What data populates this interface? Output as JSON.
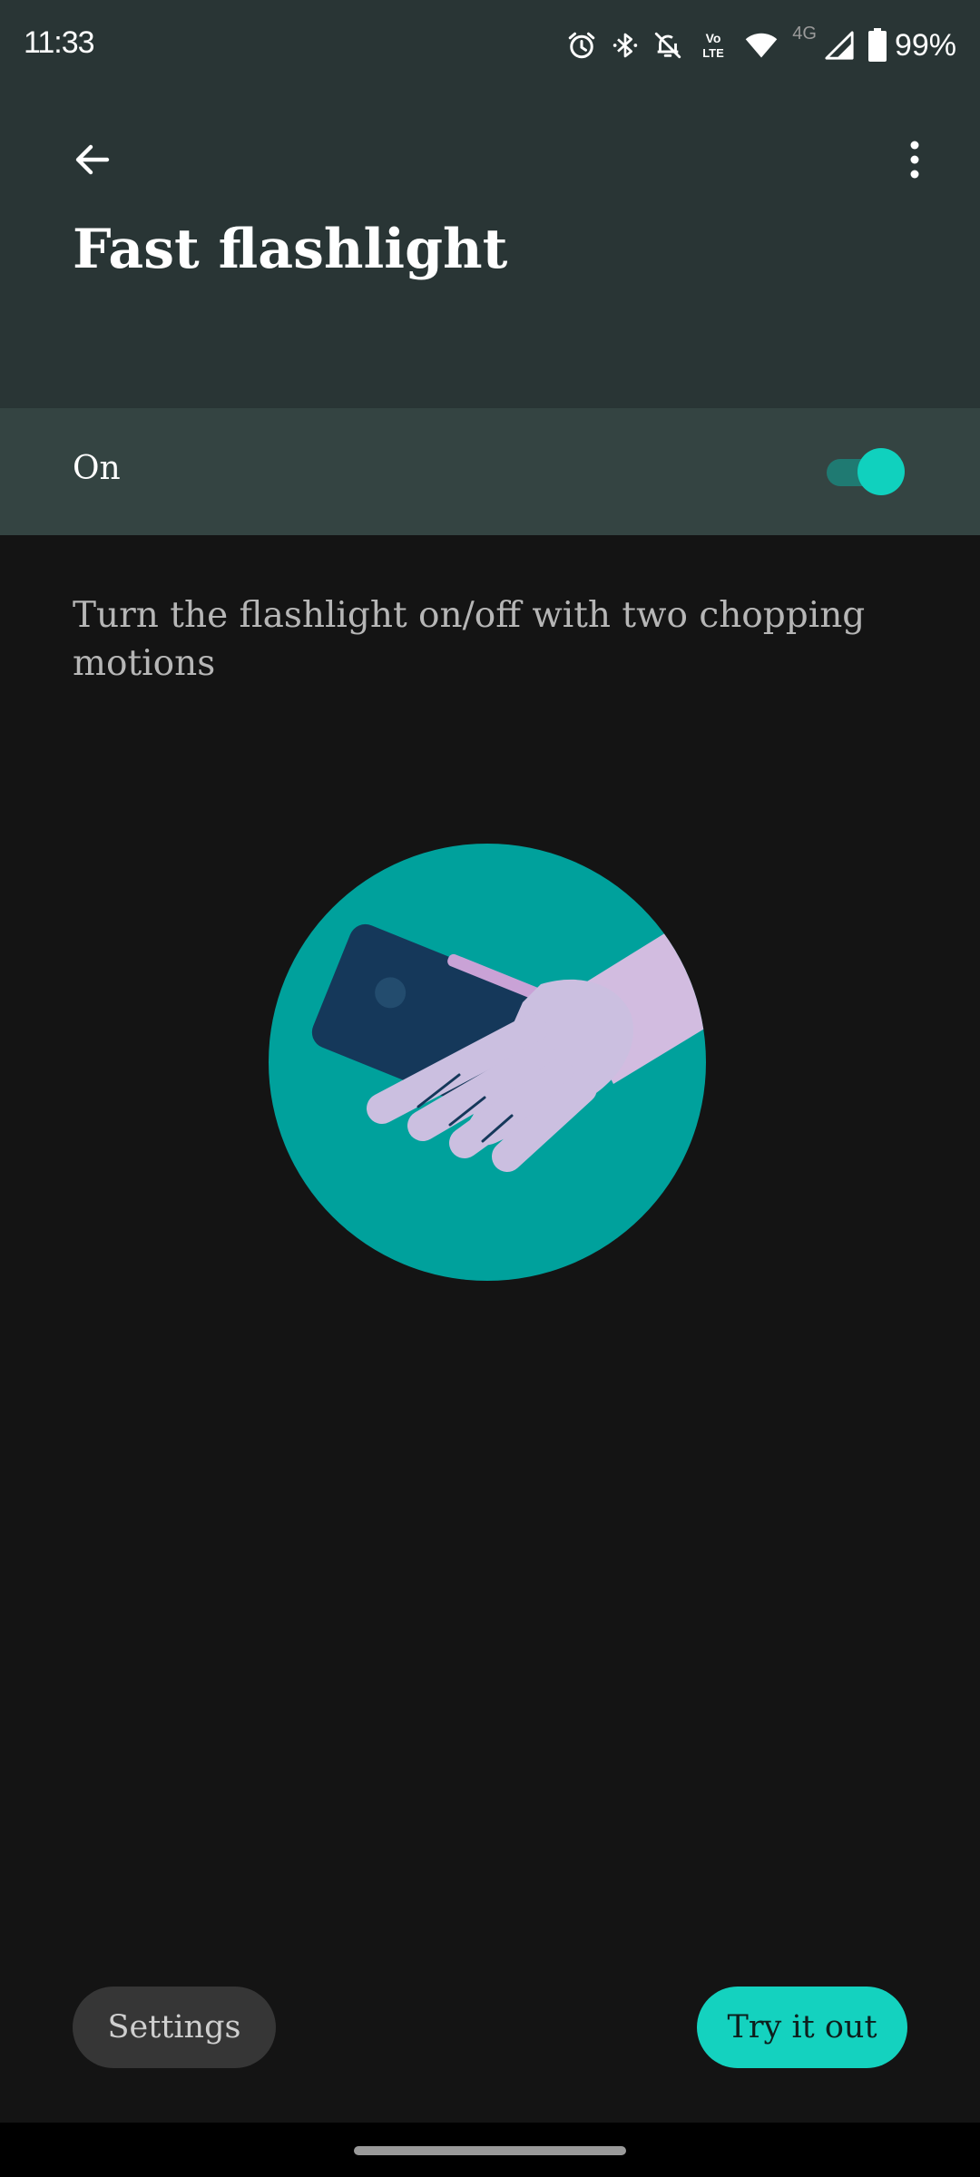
{
  "status_bar": {
    "time": "11:33",
    "battery_percent": "99%",
    "network_label": "4G",
    "volte_top": "Vo",
    "volte_bottom": "LTE",
    "icons": [
      "alarm-icon",
      "bluetooth-icon",
      "notifications-off-icon",
      "volte-icon",
      "wifi-icon",
      "cell-signal-icon",
      "battery-icon"
    ]
  },
  "app_bar": {
    "back_icon": "arrow-back-icon",
    "more_icon": "more-vert-icon",
    "title": "Fast flashlight"
  },
  "toggle": {
    "label": "On",
    "state": true,
    "accent_color": "#10d1be"
  },
  "description": "Turn the flashlight on/off with two chopping motions",
  "illustration": {
    "subject": "hand-holding-phone-illustration",
    "circle_color": "#00a19c",
    "hand_color": "#cdbee0",
    "phone_color": "#15385a"
  },
  "buttons": {
    "settings": "Settings",
    "try_it_out": "Try it out"
  },
  "colors": {
    "app_bar_bg": "#293535",
    "toggle_row_bg": "#344442",
    "page_bg": "#141414",
    "primary": "#14d2bf"
  }
}
